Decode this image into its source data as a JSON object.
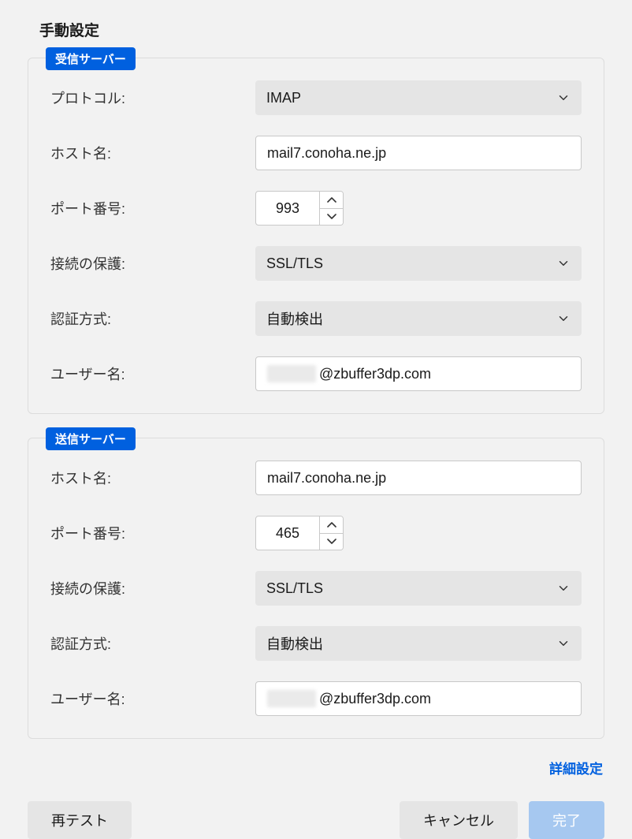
{
  "heading": "手動設定",
  "incoming": {
    "legend": "受信サーバー",
    "labels": {
      "protocol": "プロトコル:",
      "hostname": "ホスト名:",
      "port": "ポート番号:",
      "security": "接続の保護:",
      "auth": "認証方式:",
      "username": "ユーザー名:"
    },
    "values": {
      "protocol": "IMAP",
      "hostname": "mail7.conoha.ne.jp",
      "port": "993",
      "security": "SSL/TLS",
      "auth": "自動検出",
      "username_suffix": "@zbuffer3dp.com"
    }
  },
  "outgoing": {
    "legend": "送信サーバー",
    "labels": {
      "hostname": "ホスト名:",
      "port": "ポート番号:",
      "security": "接続の保護:",
      "auth": "認証方式:",
      "username": "ユーザー名:"
    },
    "values": {
      "hostname": "mail7.conoha.ne.jp",
      "port": "465",
      "security": "SSL/TLS",
      "auth": "自動検出",
      "username_suffix": "@zbuffer3dp.com"
    }
  },
  "advanced_link": "詳細設定",
  "buttons": {
    "retest": "再テスト",
    "cancel": "キャンセル",
    "done": "完了"
  }
}
